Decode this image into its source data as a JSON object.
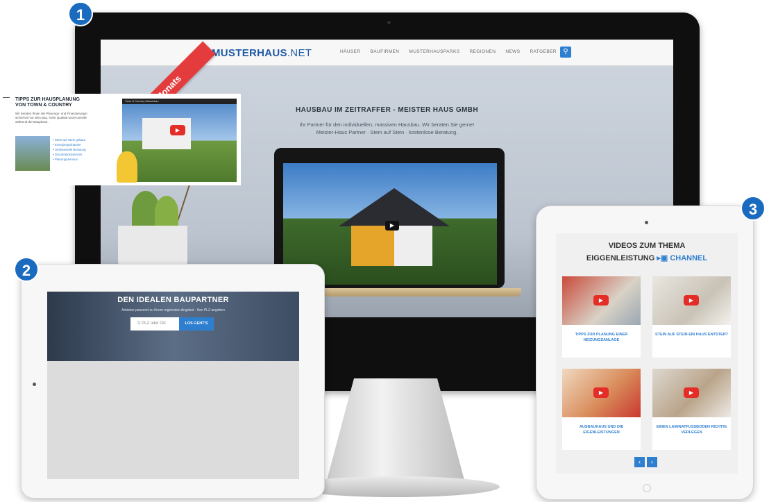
{
  "badges": [
    "1",
    "2",
    "3"
  ],
  "monitor": {
    "logo": {
      "main": "MUSTERHAUS",
      "suffix": ".NET"
    },
    "nav": [
      "HÄUSER",
      "BAUFIRMEN",
      "MUSTERHAUSPARKS",
      "REGIONEN",
      "NEWS",
      "RATGEBER"
    ],
    "ribbon": "Video des Monats",
    "hero_title": "HAUSBAU IM ZEITRAFFER - MEISTER HAUS GMBH",
    "hero_text_1": "Ihr Partner für den individuellen, massiven Hausbau. Wir beraten Sie gerne!",
    "hero_text_2": "Meister-Haus Partner · Stein auf Stein · kostenlose Beratung."
  },
  "tablet_landscape": {
    "title": "DEN IDEALEN BAUPARTNER",
    "subtitle": "Anbieter passend zu Ihrem regionalen Angebot · Ihre PLZ angeben",
    "input_placeholder": "PLZ oder Ort",
    "button": "LOS GEHT'S",
    "card_title": "TIPPS ZUR HAUSPLANUNG VON TOWN & COUNTRY",
    "card_body": "Wir beraten Ihnen die Planungs- und Finanzierungs­sicherheit vor dem Bau, hohe Qualität und Kontrolle während der Bauphase.",
    "video_bar": "Town & Country Massivbau",
    "links": [
      "Stein auf Stein gebaut",
      "Energiesparhäuser",
      "Umfassende Beratung",
      "Grundstücksservice",
      "Planungsservice"
    ]
  },
  "tablet_portrait": {
    "title_1": "VIDEOS ZUM THEMA",
    "title_2": "EIGGENLEISTUNG",
    "channel": "CHANNEL",
    "videos": [
      {
        "label": "TIPPS ZUR PLANUNG EINER HEIZUNGSANLAGE"
      },
      {
        "label": "STEIN AUF STEIN EIN HAUS ENTSTEHT"
      },
      {
        "label": "AUSBAUHAUS UND DIE EIGENLEISTUNGEN"
      },
      {
        "label": "EINEN LAMINATFUSSBODEN RICHTIG VERLEGEN"
      }
    ]
  }
}
